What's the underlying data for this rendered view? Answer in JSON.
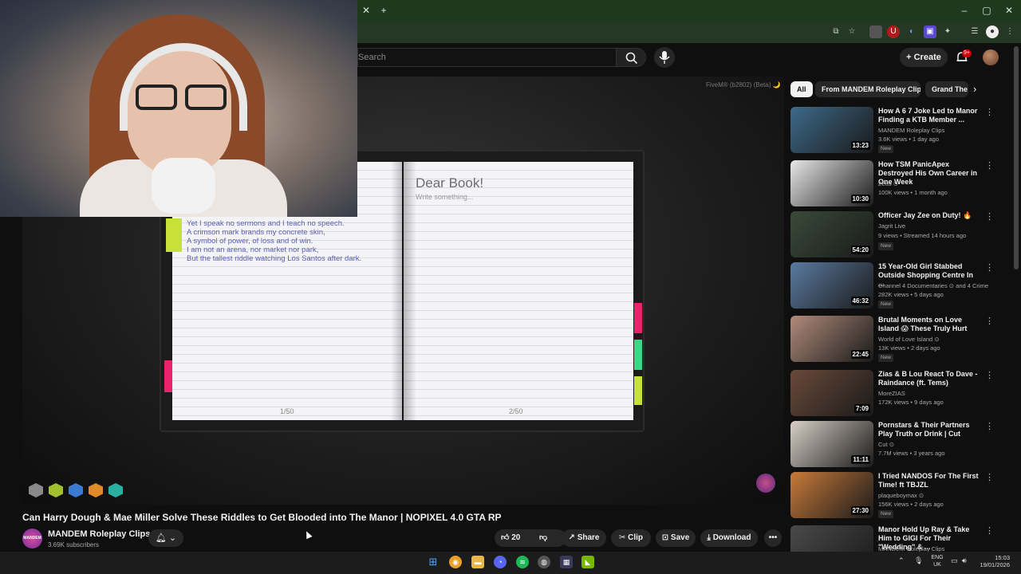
{
  "search": {
    "placeholder": "Search"
  },
  "header": {
    "create_label": "Create",
    "notifications": "9+"
  },
  "video": {
    "watermark": "FiveM® (b2802) (Beta) 🌙",
    "book": {
      "poem": [
        "Yet I speak no sermons and I teach no speech.",
        "A crimson mark brands my concrete skin,",
        "A symbol of power, of loss and of win.",
        "I am not an arena, nor market nor park,",
        "But the tallest riddle watching Los Santos after dark."
      ],
      "right_title": "Dear Book!",
      "right_placeholder": "Write something...",
      "left_page_num": "1/50",
      "right_page_num": "2/50"
    },
    "title": "Can Harry Dough & Mae Miller Solve These Riddles to Get Blooded into The Manor | NOPIXEL 4.0 GTA RP",
    "channel": "MANDEM Roleplay Clips",
    "channel_avatar_text": "MANDEM",
    "subscribers": "3.69K subscribers",
    "likes": "20",
    "share": "Share",
    "clip": "Clip",
    "save": "Save",
    "download": "Download"
  },
  "chips": [
    "All",
    "From MANDEM Roleplay Clips",
    "Grand The"
  ],
  "recommendations": [
    {
      "title": "How A 6 7 Joke Led to Manor Finding a KTB Member ...",
      "channel": "MANDEM Roleplay Clips",
      "meta": "3.6K views • 1 day ago",
      "duration": "13:23",
      "badge": "New",
      "thumb": "#3d6a8a"
    },
    {
      "title": "How TSM PanicApex Destroyed His Own Career in One Week",
      "channel": "Zeus ⊙",
      "meta": "100K views • 1 month ago",
      "duration": "10:30",
      "badge": "",
      "thumb": "#e8e8e8"
    },
    {
      "title": "Officer Jay Zee on Duty! 🔥",
      "channel": "Jagrit Live",
      "meta": "9 views • Streamed 14 hours ago",
      "duration": "54:20",
      "badge": "New",
      "thumb": "#3a4a3a"
    },
    {
      "title": "15 Year-Old Girl Stabbed Outside Shopping Centre In ...",
      "channel": "Channel 4 Documentaries ⊙ and 4 Crime",
      "meta": "282K views • 5 days ago",
      "duration": "46:32",
      "badge": "New",
      "thumb": "#5a7aa0"
    },
    {
      "title": "Brutal Moments on Love Island 😱 These Truly Hurt",
      "channel": "World of Love Island ⊙",
      "meta": "13K views • 2 days ago",
      "duration": "22:45",
      "badge": "New",
      "thumb": "#b08a7a"
    },
    {
      "title": "Zias & B Lou React To Dave - Raindance (ft. Tems)",
      "channel": "MoreZIAS",
      "meta": "172K views • 9 days ago",
      "duration": "7:09",
      "badge": "",
      "thumb": "#6a4a3a"
    },
    {
      "title": "Pornstars & Their Partners Play Truth or Drink | Cut",
      "channel": "Cut ⊙",
      "meta": "7.7M views • 3 years ago",
      "duration": "11:11",
      "badge": "",
      "thumb": "#d8d0c8"
    },
    {
      "title": "I Tried NANDOS For The First Time! ft TBJZL",
      "channel": "plaqueboymax ⊙",
      "meta": "156K views • 2 days ago",
      "duration": "27:30",
      "badge": "New",
      "thumb": "#c87a3a"
    },
    {
      "title": "Manor Hold Up Ray & Take Him to GIGI For Their \"Wedding\" & ...",
      "channel": "MANDEM Roleplay Clips",
      "meta": "",
      "duration": "",
      "badge": "",
      "thumb": "#4a4a4a"
    }
  ],
  "taskbar": {
    "lang_top": "ENG",
    "lang_bottom": "UK",
    "time": "15:03",
    "date": "19/01/2026"
  },
  "colors": {
    "accent_red": "#cc0000",
    "chrome_green": "#1e3a1e",
    "page": "#f4f3f6",
    "poem_ink": "#5a5fb0"
  }
}
